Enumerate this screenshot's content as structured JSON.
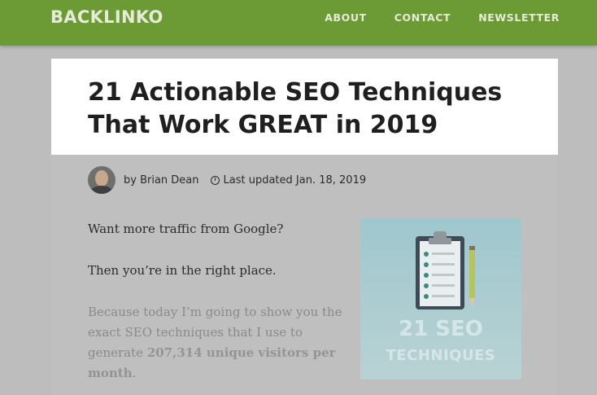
{
  "header": {
    "logo": "BACKLINKO",
    "nav": [
      "ABOUT",
      "CONTACT",
      "NEWSLETTER"
    ]
  },
  "article": {
    "title_line1": "21 Actionable SEO Techniques",
    "title_line2": "That Work GREAT in 2019",
    "author": "by Brian Dean",
    "updated": "Last updated Jan. 18, 2019",
    "p1": "Want more traffic from Google?",
    "p2": "Then you’re in the right place.",
    "p3_a": "Because today I’m going to show you the exact SEO techniques that I use to generate ",
    "p3_bold": "207,314 unique visitors per month",
    "p3_end": "."
  },
  "hero": {
    "line1": "21 SEO",
    "line2": "TECHNIQUES"
  },
  "colors": {
    "header_bg": "#6c9a34",
    "overlay": "#bdbdbd",
    "hero_bg": "#9ec7cd"
  },
  "icons": [
    "clock-icon",
    "clipboard-icon",
    "pencil-icon",
    "avatar"
  ]
}
